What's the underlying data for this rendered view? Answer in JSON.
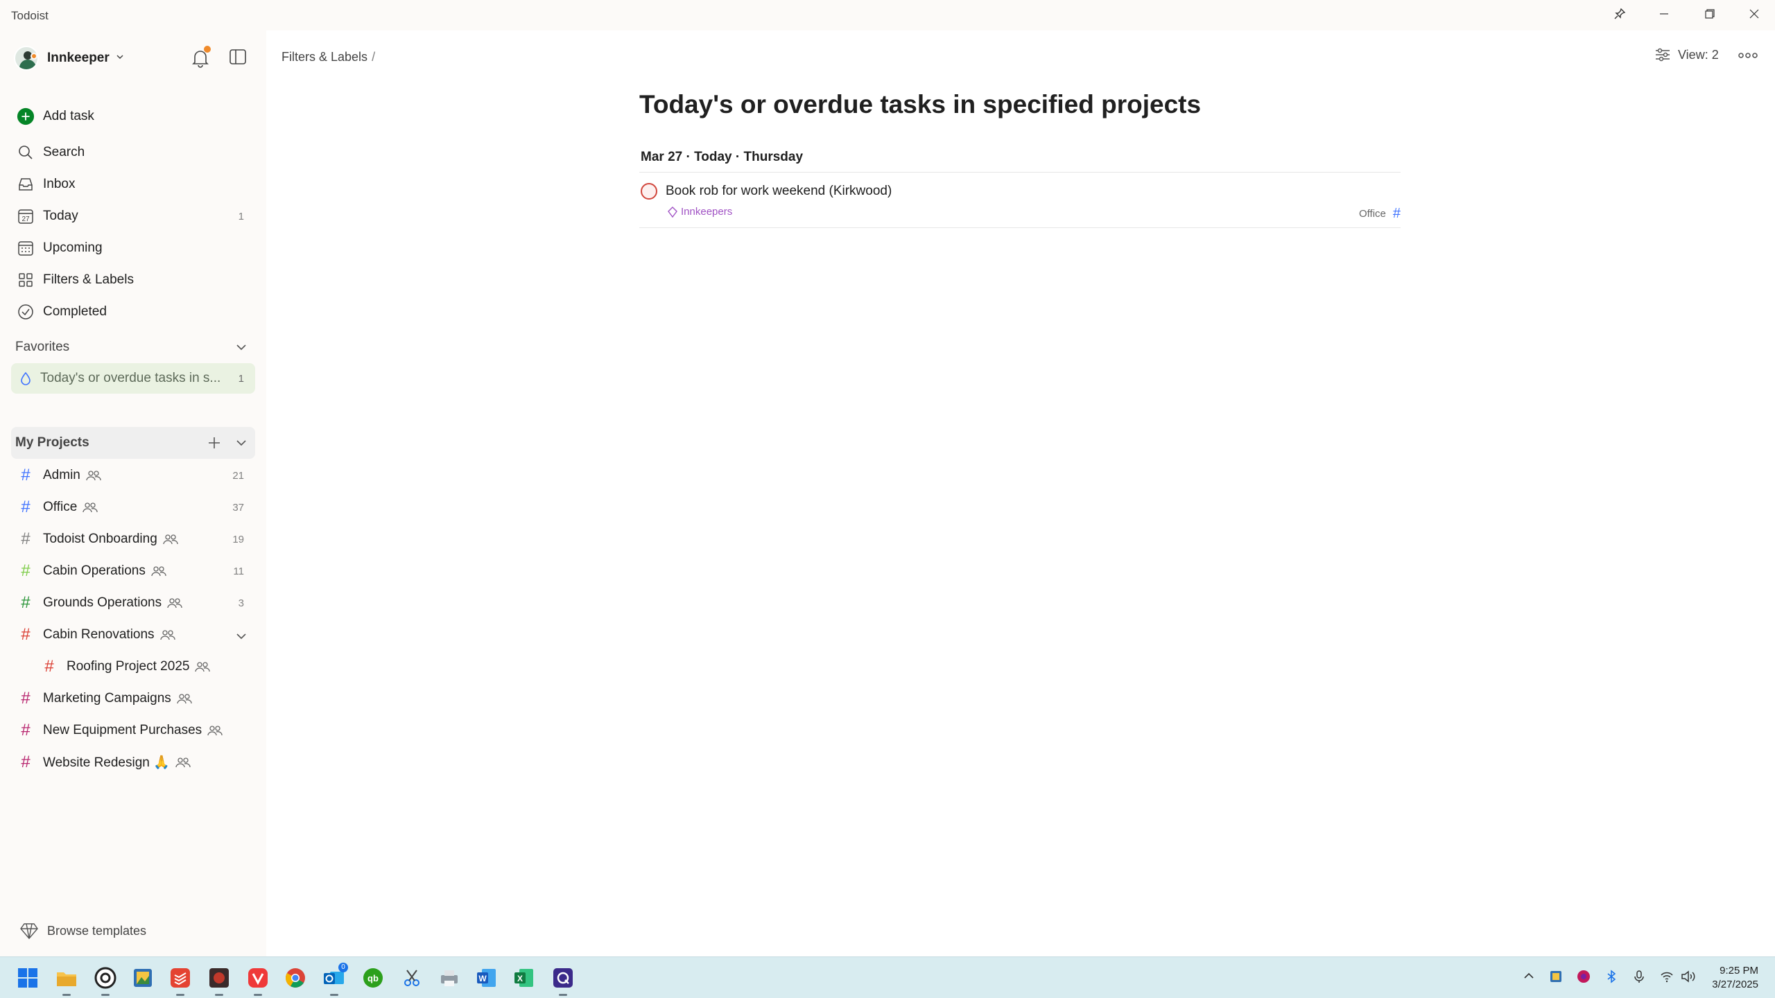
{
  "window": {
    "app_title": "Todoist"
  },
  "user": {
    "name": "Innkeeper"
  },
  "nav": {
    "add_task": "Add task",
    "search": "Search",
    "inbox": "Inbox",
    "today": "Today",
    "today_count": "1",
    "upcoming": "Upcoming",
    "filters_labels": "Filters & Labels",
    "completed": "Completed",
    "today_icon_number": "27"
  },
  "favorites": {
    "header": "Favorites",
    "items": [
      {
        "label": "Today's or overdue tasks in s...",
        "count": "1"
      }
    ]
  },
  "projects": {
    "header": "My Projects",
    "items": [
      {
        "name": "Admin",
        "count": "21",
        "color": "#4073ff"
      },
      {
        "name": "Office",
        "count": "37",
        "color": "#4073ff"
      },
      {
        "name": "Todoist Onboarding",
        "count": "19",
        "color": "#808080"
      },
      {
        "name": "Cabin Operations",
        "count": "11",
        "color": "#7ecc49"
      },
      {
        "name": "Grounds Operations",
        "count": "3",
        "color": "#299438"
      },
      {
        "name": "Cabin Renovations",
        "count": "",
        "color": "#db4035"
      },
      {
        "name": "Roofing Project 2025",
        "count": "",
        "color": "#db4035"
      },
      {
        "name": "Marketing Campaigns",
        "count": "",
        "color": "#b8256f"
      },
      {
        "name": "New Equipment Purchases",
        "count": "",
        "color": "#b8256f"
      },
      {
        "name": "Website Redesign 🙏",
        "count": "",
        "color": "#b8256f"
      }
    ]
  },
  "browse_templates": "Browse templates",
  "main": {
    "breadcrumb": "Filters & Labels",
    "breadcrumb_sep": "/",
    "view_label": "View: 2",
    "title": "Today's or overdue tasks in specified projects",
    "date_header": "Mar 27 · Today · Thursday",
    "tasks": [
      {
        "title": "Book rob for work weekend (Kirkwood)",
        "label": "Innkeepers",
        "project": "Office"
      }
    ]
  },
  "taskbar": {
    "time": "9:25 PM",
    "date": "3/27/2025",
    "outlook_badge": "0"
  },
  "colors": {
    "accent": "#dc4c3e",
    "task_priority": "#d1453b",
    "label": "#a052c4",
    "favorite_bg": "#eaf2e2"
  }
}
